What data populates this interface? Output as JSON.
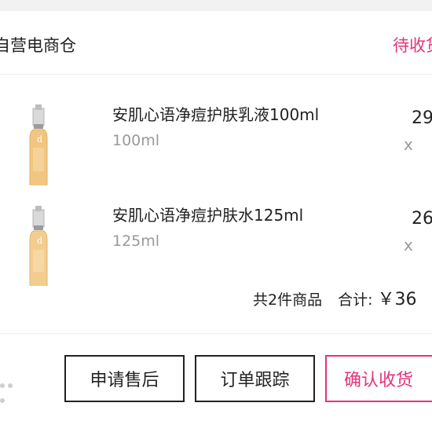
{
  "order": {
    "store_name": "自营电商仓",
    "status": "待收货"
  },
  "products": [
    {
      "name": "安肌心语净痘护肤乳液100ml",
      "spec": "100ml",
      "price_partial": "29",
      "qty_label": "x"
    },
    {
      "name": "安肌心语净痘护肤水125ml",
      "spec": "125ml",
      "price_partial": "26",
      "qty_label": "x"
    }
  ],
  "summary": {
    "count_text": "共2件商品",
    "total_label": "合计:",
    "total_value": "￥36"
  },
  "actions": {
    "after_sales": "申请售后",
    "track_order": "订单跟踪",
    "confirm_receipt": "确认收货"
  },
  "colors": {
    "accent": "#e6327a",
    "background": "#f2f2f2",
    "card": "#ffffff",
    "bottle_liquid": "#f1c681",
    "bottle_cap": "#c9c9c9"
  }
}
